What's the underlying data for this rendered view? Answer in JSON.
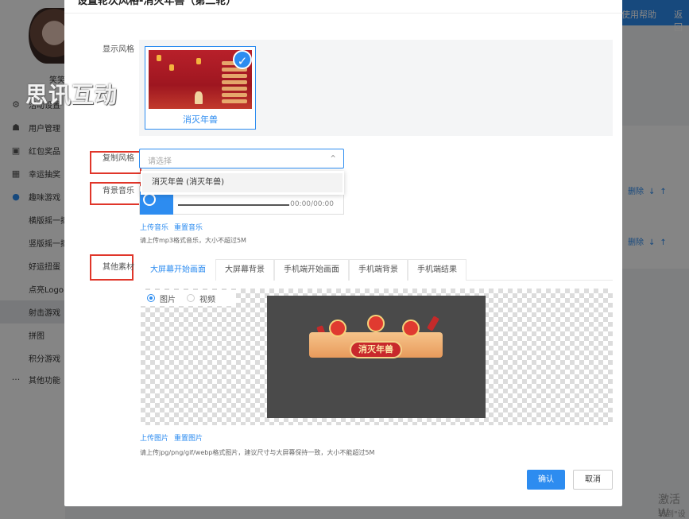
{
  "modal": {
    "title": "设置轮次风格-消灭年兽（第二轮）",
    "close_icon": "×",
    "fields": {
      "display_style_label": "显示风格",
      "copy_style_label": "复制风格",
      "bg_music_label": "背景音乐",
      "other_material_label": "其他素材"
    },
    "style_option": {
      "name": "消灭年兽",
      "selected": true
    },
    "copy_select": {
      "placeholder": "请选择",
      "dropdown_option": "消灭年兽 (消灭年兽)"
    },
    "music": {
      "time": "00:00/00:00",
      "upload_link": "上传音乐",
      "reset_link": "重置音乐",
      "hint": "请上传mp3格式音乐，大小不超过5M"
    },
    "material_tabs": [
      "大屏幕开始画面",
      "大屏幕背景",
      "手机端开始画面",
      "手机端背景",
      "手机端结果"
    ],
    "media_types": [
      "图片",
      "视频"
    ],
    "preview_banner_text": "消灭年兽",
    "image": {
      "upload_link": "上传图片",
      "reset_link": "重置图片",
      "hint": "请上传jpg/png/gif/webp格式图片，建议尺寸与大屏幕保持一致，大小不能超过5M"
    },
    "buttons": {
      "confirm": "确认",
      "cancel": "取消"
    }
  },
  "watermark": "思讯互动",
  "background": {
    "topbar": [
      "使用帮助",
      "返回"
    ],
    "user": "笑笑",
    "nav": [
      "活动设置",
      "用户管理",
      "红包奖品",
      "幸运抽奖",
      "趣味游戏",
      "横版摇一摇",
      "竖版摇一摇",
      "好运扭蛋",
      "点亮Logo",
      "射击游戏",
      "拼图",
      "积分游戏",
      "其他功能"
    ],
    "row_ops": [
      "删除",
      "↓",
      "↑"
    ],
    "activate_line1": "激活 W",
    "activate_line2": "转到\"设"
  },
  "colors": {
    "accent": "#2d8cf0",
    "highlight_box": "#e0362a"
  }
}
